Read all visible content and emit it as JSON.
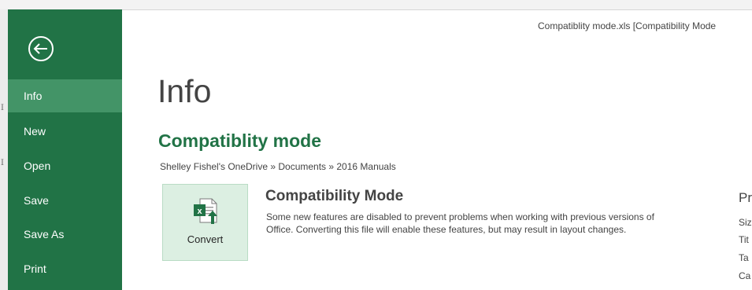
{
  "window": {
    "title": "Compatiblity mode.xls  [Compatibility Mode"
  },
  "sidebar": {
    "items": [
      {
        "label": "Info",
        "active": true
      },
      {
        "label": "New",
        "active": false
      },
      {
        "label": "Open",
        "active": false
      },
      {
        "label": "Save",
        "active": false
      },
      {
        "label": "Save As",
        "active": false
      },
      {
        "label": "Print",
        "active": false
      }
    ],
    "back_icon": "back-arrow-circle-icon",
    "color": "#217346",
    "active_color": "#439467"
  },
  "main": {
    "page_title": "Info",
    "doc_title": "Compatiblity mode",
    "breadcrumb": "Shelley Fishel's OneDrive » Documents » 2016 Manuals",
    "convert": {
      "label": "Convert",
      "icon": "excel-convert-icon"
    },
    "compat": {
      "heading": "Compatibility Mode",
      "description": "Some new features are disabled to prevent problems when working with previous versions of Office. Converting this file will enable these features, but may result in layout changes."
    },
    "properties": {
      "heading": "Pr",
      "labels": [
        "Siz",
        "Tit",
        "Ta",
        "Ca"
      ]
    }
  },
  "background": {
    "row_marks": [
      "I",
      "I"
    ]
  }
}
